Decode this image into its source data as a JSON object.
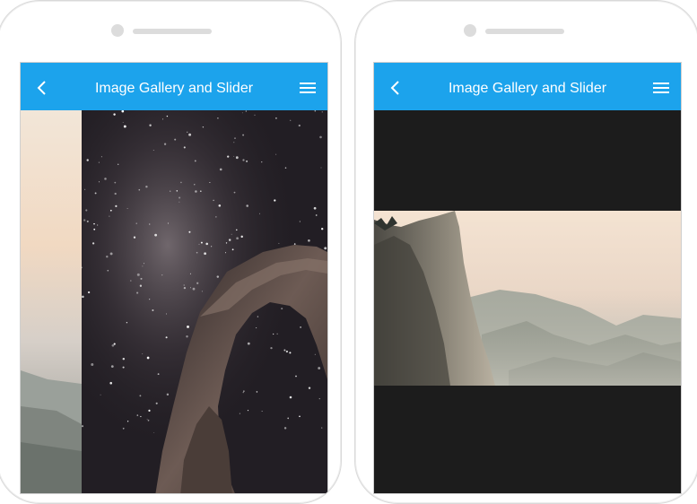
{
  "app": {
    "title": "Image Gallery and Slider"
  },
  "icons": {
    "back": "chevron-left-icon",
    "menu": "hamburger-menu-icon"
  },
  "colors": {
    "appbar": "#1ca3ec",
    "viewer_background": "#1c1c1c"
  },
  "phones": [
    {
      "screen": "slider-transition",
      "images": [
        "valley-sunrise-photo",
        "starry-night-arch-photo"
      ]
    },
    {
      "screen": "image-viewer",
      "images": [
        "cliff-valley-photo"
      ]
    }
  ]
}
